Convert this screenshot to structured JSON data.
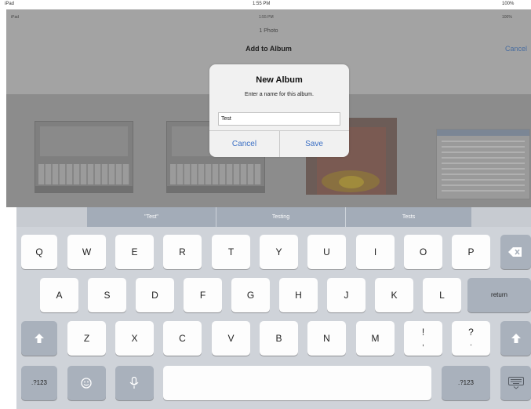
{
  "outer_status": {
    "left": "iPad",
    "time": "1:55 PM",
    "right": "100%"
  },
  "app": {
    "status": {
      "left": "iPad",
      "time": "1:55 PM",
      "right": "100%"
    },
    "nav_subtitle": "1 Photo",
    "nav_title": "Add to Album",
    "nav_cancel": "Cancel"
  },
  "alert": {
    "title": "New Album",
    "message": "Enter a name for this album.",
    "input_value": "Test",
    "cancel_label": "Cancel",
    "save_label": "Save"
  },
  "keyboard": {
    "suggestions": [
      "\"Test\"",
      "Testing",
      "Tests"
    ],
    "row1": [
      "Q",
      "W",
      "E",
      "R",
      "T",
      "Y",
      "U",
      "I",
      "O",
      "P"
    ],
    "row2": [
      "A",
      "S",
      "D",
      "F",
      "G",
      "H",
      "J",
      "K",
      "L"
    ],
    "row3": [
      "Z",
      "X",
      "C",
      "V",
      "B",
      "N",
      "M",
      "!",
      "?"
    ],
    "row3_sub": [
      ",",
      "."
    ],
    "return_label": "return",
    "numbers_label": ".?123"
  },
  "icons": {
    "delete": "delete-icon",
    "shift": "shift-icon",
    "emoji": "emoji-icon",
    "dictation": "microphone-icon",
    "hide_keyboard": "hide-keyboard-icon"
  },
  "colors": {
    "accent": "#3b6fc4",
    "keyboard_bg": "#cfd3d9",
    "dark_key": "#a9b1bc"
  }
}
